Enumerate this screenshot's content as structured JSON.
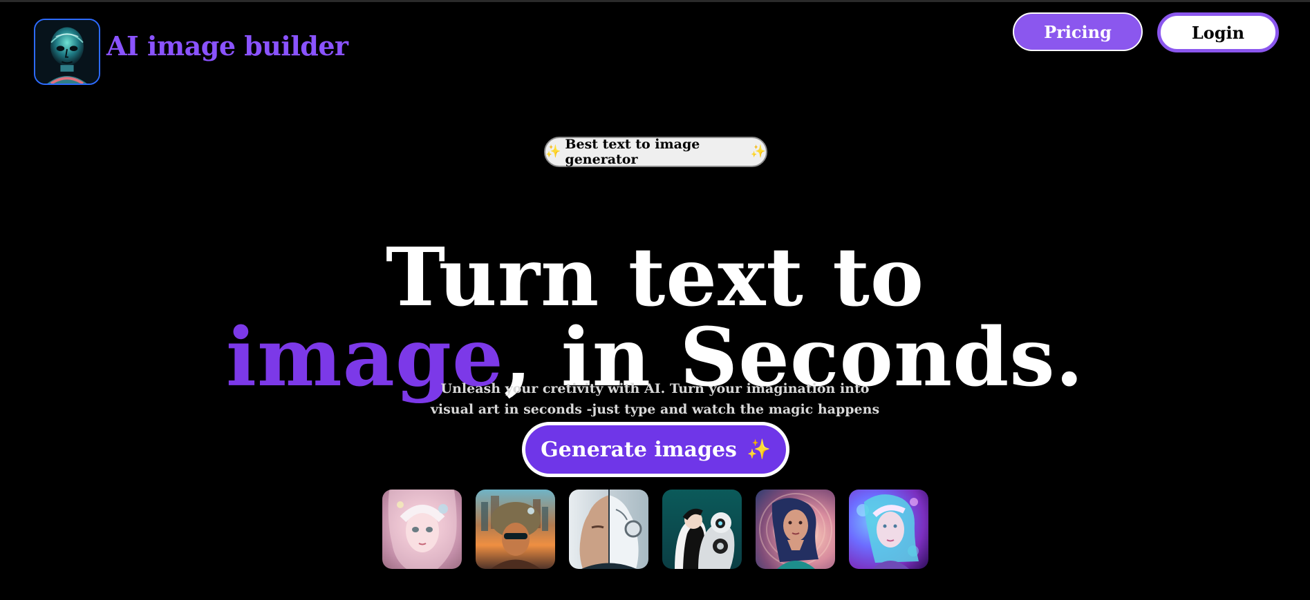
{
  "header": {
    "brand": "AI image builder",
    "pricing_label": "Pricing",
    "login_label": "Login"
  },
  "hero": {
    "badge_text": "Best text to image generator",
    "line1": "Turn text to",
    "highlight": "image",
    "line2_rest": ", in Seconds.",
    "subtext_line1": "Unleash your cretivity with AI. Turn your imagination into",
    "subtext_line2": "visual art in seconds -just type and watch the magic happens",
    "cta_label": "Generate images"
  },
  "icons": {
    "logo": "robot-face-icon",
    "sparkle": "sparkle-icon"
  },
  "gallery": {
    "items": [
      "pink-haired-fantasy-girl",
      "surreal-cityscape-portrait",
      "half-human-half-robot-profile",
      "human-and-robot-silhouettes",
      "woman-profile-portrait",
      "iridescent-fantasy-portrait"
    ]
  },
  "colors": {
    "background": "#000000",
    "brand_purple": "#8a53ff",
    "hero_purple": "#7c39e8",
    "button_purple": "#6f36e8",
    "badge_bg": "#efefef"
  }
}
